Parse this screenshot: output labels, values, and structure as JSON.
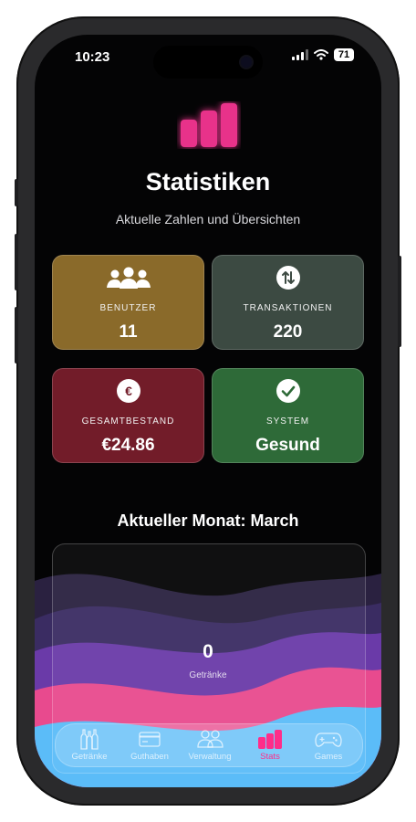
{
  "status": {
    "time": "10:23",
    "battery": "71"
  },
  "header": {
    "title": "Statistiken",
    "subtitle": "Aktuelle Zahlen und Übersichten"
  },
  "colors": {
    "accent": "#e8308a",
    "users_card": "#8a6a2a",
    "transactions_card": "#3c4a42",
    "balance_card": "#721c29",
    "system_card": "#2e6a38"
  },
  "stats": [
    {
      "label": "BENUTZER",
      "value": "11",
      "icon": "users-icon"
    },
    {
      "label": "TRANSAKTIONEN",
      "value": "220",
      "icon": "arrows-up-down-icon"
    },
    {
      "label": "GESAMTBESTAND",
      "value": "€24.86",
      "icon": "euro-icon"
    },
    {
      "label": "SYSTEM",
      "value": "Gesund",
      "icon": "checkmark-icon"
    }
  ],
  "month": {
    "title": "Aktueller Monat: March",
    "count": "0",
    "count_label": "Getränke"
  },
  "tabs": [
    {
      "label": "Getränke",
      "icon": "bottles-icon"
    },
    {
      "label": "Guthaben",
      "icon": "card-icon"
    },
    {
      "label": "Verwaltung",
      "icon": "people-icon"
    },
    {
      "label": "Stats",
      "icon": "bar-chart-icon",
      "active": true
    },
    {
      "label": "Games",
      "icon": "gamepad-icon"
    }
  ]
}
